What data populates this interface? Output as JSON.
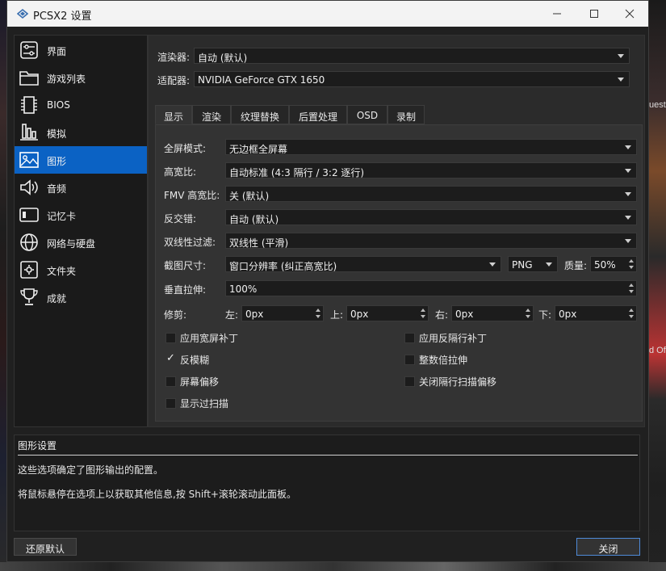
{
  "window": {
    "title": "PCSX2 设置"
  },
  "background_texts": [
    "uest",
    "d Of"
  ],
  "sidebar": {
    "items": [
      {
        "label": "界面",
        "icon": "interface-icon"
      },
      {
        "label": "游戏列表",
        "icon": "folder-icon"
      },
      {
        "label": "BIOS",
        "icon": "chip-icon"
      },
      {
        "label": "模拟",
        "icon": "emulation-icon"
      },
      {
        "label": "图形",
        "icon": "image-icon"
      },
      {
        "label": "音频",
        "icon": "speaker-icon"
      },
      {
        "label": "记忆卡",
        "icon": "memory-card-icon"
      },
      {
        "label": "网络与硬盘",
        "icon": "globe-icon"
      },
      {
        "label": "文件夹",
        "icon": "folder-gear-icon"
      },
      {
        "label": "成就",
        "icon": "trophy-icon"
      }
    ],
    "active_index": 4
  },
  "top": {
    "renderer_label": "渲染器:",
    "renderer_value": "自动 (默认)",
    "adapter_label": "适配器:",
    "adapter_value": "NVIDIA GeForce GTX 1650"
  },
  "tabs": [
    "显示",
    "渲染",
    "纹理替换",
    "后置处理",
    "OSD",
    "录制"
  ],
  "display": {
    "fullscreen_label": "全屏模式:",
    "fullscreen_value": "无边框全屏幕",
    "aspect_label": "高宽比:",
    "aspect_value": "自动标准 (4:3 隔行 / 3:2 逐行)",
    "fmv_label": "FMV 高宽比:",
    "fmv_value": "关 (默认)",
    "deinterlace_label": "反交错:",
    "deinterlace_value": "自动 (默认)",
    "bilinear_label": "双线性过滤:",
    "bilinear_value": "双线性 (平滑)",
    "screenshot_label": "截图尺寸:",
    "screenshot_value": "窗口分辨率 (纠正高宽比)",
    "screenshot_format": "PNG",
    "quality_label": "质量:",
    "quality_value": "50%",
    "vstretch_label": "垂直拉伸:",
    "vstretch_value": "100%",
    "crop_label": "修剪:",
    "crop_left_label": "左:",
    "crop_left_value": "0px",
    "crop_top_label": "上:",
    "crop_top_value": "0px",
    "crop_right_label": "右:",
    "crop_right_value": "0px",
    "crop_bottom_label": "下:",
    "crop_bottom_value": "0px"
  },
  "checkboxes": {
    "widescreen_patches": {
      "label": "应用宽屏补丁",
      "checked": false
    },
    "no_interlace_patches": {
      "label": "应用反隔行补丁",
      "checked": false
    },
    "anti_blur": {
      "label": "反模糊",
      "checked": true
    },
    "integer_scaling": {
      "label": "整数倍拉伸",
      "checked": false
    },
    "screen_offsets": {
      "label": "屏幕偏移",
      "checked": false
    },
    "disable_interlace_offset": {
      "label": "关闭隔行扫描偏移",
      "checked": false
    },
    "show_overscan": {
      "label": "显示过扫描",
      "checked": false
    }
  },
  "help": {
    "title": "图形设置",
    "line1": "这些选项确定了图形输出的配置。",
    "line2": "将鼠标悬停在选项上以获取其他信息,按 Shift+滚轮滚动此面板。"
  },
  "buttons": {
    "restore": "还原默认",
    "close": "关闭"
  },
  "colors": {
    "accent": "#0b62c4",
    "panel": "#2b2b2b",
    "field": "#1c1c1c"
  }
}
